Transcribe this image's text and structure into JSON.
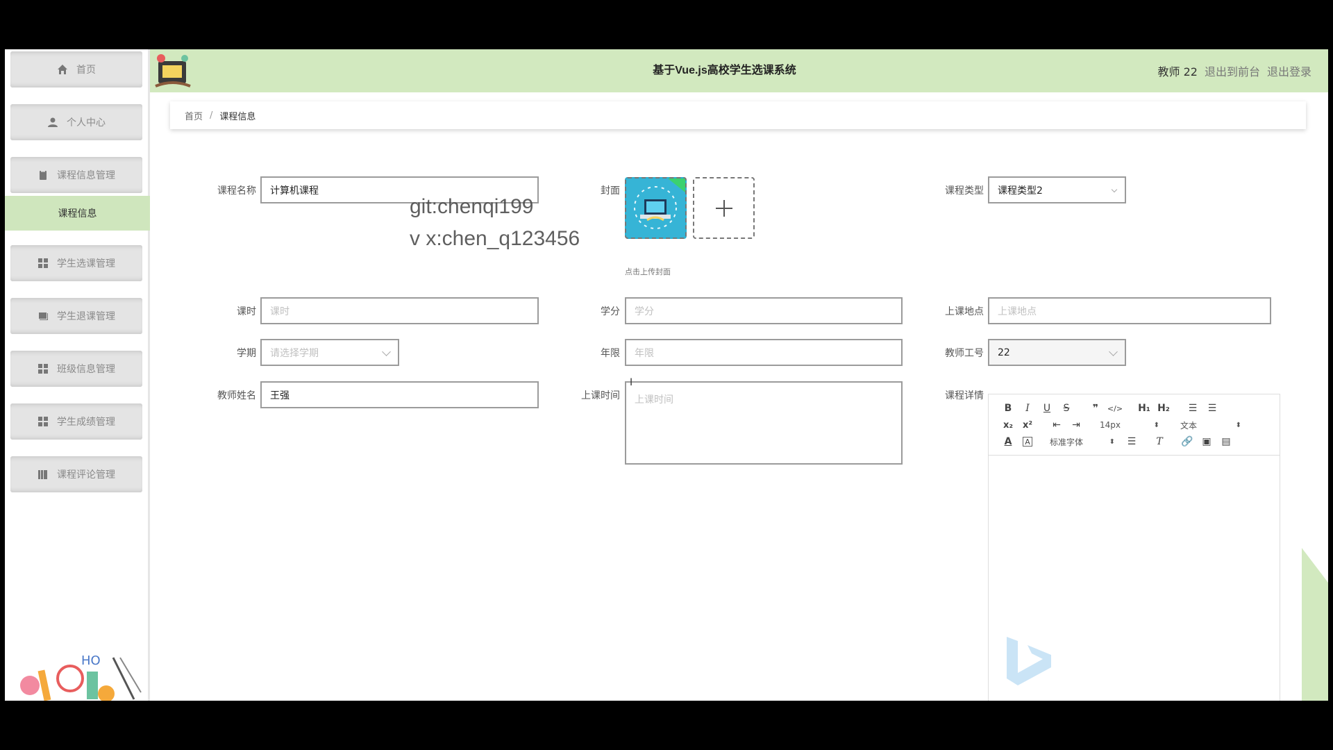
{
  "app": {
    "title": "基于Vue.js高校学生选课系统",
    "user": "教师 22",
    "to_front": "退出到前台",
    "logout": "退出登录"
  },
  "sidebar": {
    "items": [
      {
        "label": "首页",
        "icon": "home-icon"
      },
      {
        "label": "个人中心",
        "icon": "user-icon"
      },
      {
        "label": "课程信息管理",
        "icon": "document-icon"
      },
      {
        "label": "学生选课管理",
        "icon": "grid-icon"
      },
      {
        "label": "学生退课管理",
        "icon": "folder-icon"
      },
      {
        "label": "班级信息管理",
        "icon": "grid-icon"
      },
      {
        "label": "学生成绩管理",
        "icon": "grid-icon"
      },
      {
        "label": "课程评论管理",
        "icon": "books-icon"
      }
    ],
    "active_sub": "课程信息"
  },
  "breadcrumb": {
    "home": "首页",
    "sep": "/",
    "current": "课程信息"
  },
  "form": {
    "course_name": {
      "label": "课程名称",
      "value": "计算机课程"
    },
    "cover": {
      "label": "封面",
      "tip": "点击上传封面"
    },
    "course_type": {
      "label": "课程类型",
      "value": "课程类型2"
    },
    "hours": {
      "label": "课时",
      "placeholder": "课时"
    },
    "credit": {
      "label": "学分",
      "placeholder": "学分"
    },
    "location": {
      "label": "上课地点",
      "placeholder": "上课地点"
    },
    "semester": {
      "label": "学期",
      "placeholder": "请选择学期"
    },
    "years": {
      "label": "年限",
      "placeholder": "年限"
    },
    "teacher_id": {
      "label": "教师工号",
      "value": "22"
    },
    "teacher_name": {
      "label": "教师姓名",
      "value": "王强"
    },
    "class_time": {
      "label": "上课时间",
      "placeholder": "上课时间"
    },
    "details": {
      "label": "课程详情"
    }
  },
  "editor": {
    "font_size": "14px",
    "header_select": "文本",
    "font_family": "标准字体",
    "h1": "H₁",
    "h2": "H₂"
  },
  "watermark": {
    "line1": "git:chenqi199",
    "line2": "v x:chen_q123456"
  },
  "colors": {
    "header_bg": "#d2e9bf",
    "active_sub_bg": "#cfe6bd",
    "menu_bg": "#e4e4e4"
  }
}
